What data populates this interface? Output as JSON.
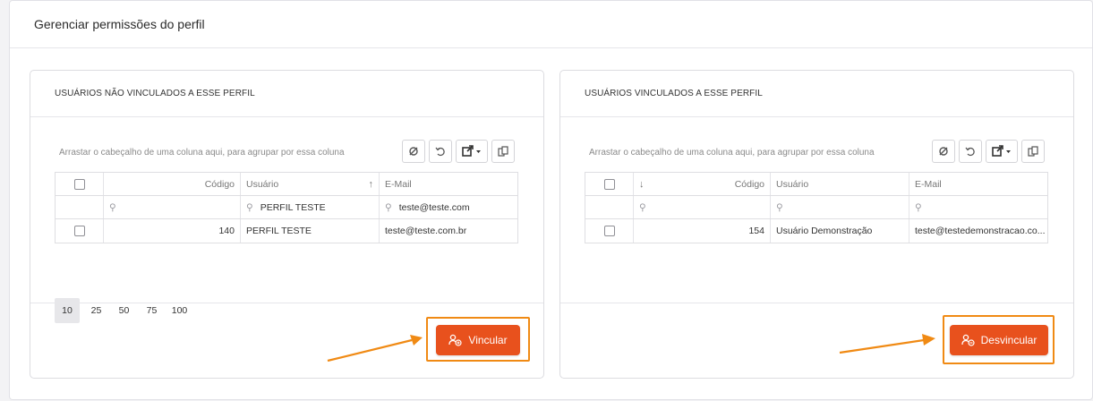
{
  "page": {
    "title": "Gerenciar permissões do perfil"
  },
  "left": {
    "title": "USUÁRIOS NÃO VINCULADOS A ESSE PERFIL",
    "group_hint": "Arrastar o cabeçalho de uma coluna aqui, para agrupar por essa coluna",
    "columns": {
      "code": "Código",
      "user": "Usuário",
      "email": "E-Mail"
    },
    "filters": {
      "code": "",
      "user": "PERFIL TESTE",
      "email": "teste@teste.com"
    },
    "rows": [
      {
        "code": "140",
        "user": "PERFIL TESTE",
        "email": "teste@teste.com.br"
      }
    ],
    "page_sizes": [
      "10",
      "25",
      "50",
      "75",
      "100"
    ],
    "action_label": "Vincular"
  },
  "right": {
    "title": "USUÁRIOS VINCULADOS A ESSE PERFIL",
    "group_hint": "Arrastar o cabeçalho de uma coluna aqui, para agrupar por essa coluna",
    "columns": {
      "code": "Código",
      "user": "Usuário",
      "email": "E-Mail"
    },
    "filters": {
      "code": "",
      "user": "",
      "email": ""
    },
    "rows": [
      {
        "code": "154",
        "user": "Usuário Demonstração",
        "email": "teste@testedemonstracao.co..."
      }
    ],
    "action_label": "Desvincular"
  },
  "colors": {
    "accent": "#e8511d",
    "highlight": "#f08a14"
  }
}
